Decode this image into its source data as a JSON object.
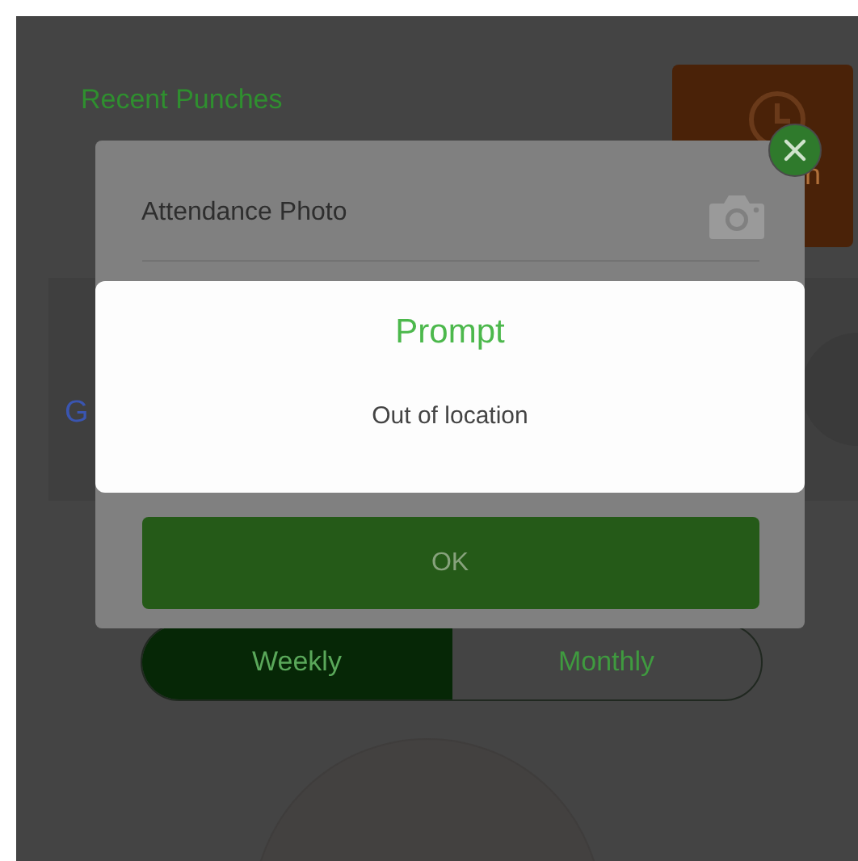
{
  "background": {
    "section_title": "Recent Punches",
    "punch_card_label": "n",
    "group_initial": "G",
    "period_tabs": [
      {
        "label": "Weekly",
        "selected": true
      },
      {
        "label": "Monthly",
        "selected": false
      }
    ]
  },
  "dialog": {
    "photo_label": "Attendance Photo",
    "prompt": {
      "title": "Prompt",
      "message": "Out of location"
    },
    "ok_button": "OK"
  }
}
